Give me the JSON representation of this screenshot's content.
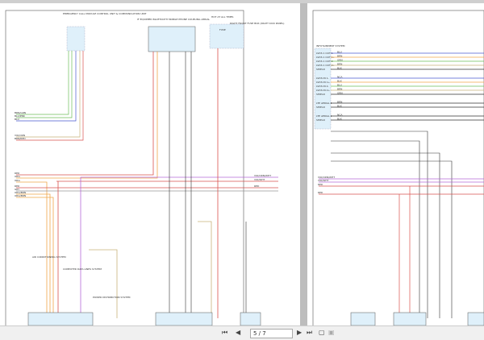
{
  "viewer": {
    "page_indicator": "5 / 7",
    "icons": [
      "first-page-icon",
      "prev-page-icon",
      "next-page-icon",
      "last-page-icon",
      "single-page-icon",
      "two-page-icon"
    ]
  },
  "left_page": {
    "modules": {
      "ecall": "EMERGENCY CALL MODULE CONTROL UNIT & COMMUNICATION UNIT",
      "bluetooth": "IF EQUIPPED BLUETOOTH MOBILE PHONE COUPLING AERIAL",
      "hot": "HOT AT ALL TIMES",
      "fuse": "FUSE",
      "fusebox": "RIGHT FRONT FUSE BOX (RIGHT KICK PANEL)",
      "ac": "AIR CONDITIONING SYSTEM",
      "datalink": "COMPUTER DATA LINES SYSTEM",
      "power": "POWER DISTRIBUTION SYSTEM",
      "ground": "G"
    },
    "wires": [
      "BRN/GRN",
      "BLU/PNK",
      "BLU",
      "VIO/ORN",
      "BRN/RED",
      "RED",
      "ORG",
      "ORG",
      "RED",
      "GRY",
      "ORG/BRN",
      "ORG/BRN"
    ],
    "right_wires": [
      "VIO/ORN/WHT",
      "VIO/WHT",
      "RED"
    ]
  },
  "right_page": {
    "module": "INFOTAINMENT SYSTEM",
    "pins": [
      "LVDS 1 OUT 1-",
      "LVDS 1 OUT 1+",
      "LVDS 1 OUT 2-",
      "LVDS 1 OUT 2+",
      "SHIELD",
      "LVDS IN 1-",
      "LVDS IN 1+",
      "LVDS IN 2-",
      "LVDS IN 2+",
      "SHIELD",
      "LTE AERIAL 2",
      "SHIELD",
      "LTE AERIAL 1",
      "SHIELD"
    ],
    "wire_labels": [
      "BLU",
      "BRN",
      "GRN",
      "BRN",
      "BLK",
      "NCA",
      "BLK"
    ],
    "left_wires": [
      "VIO/ORN/WHT",
      "VIO/WHT",
      "RED",
      "RED"
    ]
  },
  "colors": {
    "red": "#d9534f",
    "orange": "#f0a64a",
    "green": "#6cbf5a",
    "blue": "#4a5ad0",
    "violet": "#b56ad8",
    "tan": "#c9b27a",
    "black": "#333333",
    "module_fill": "#dff0fa"
  }
}
